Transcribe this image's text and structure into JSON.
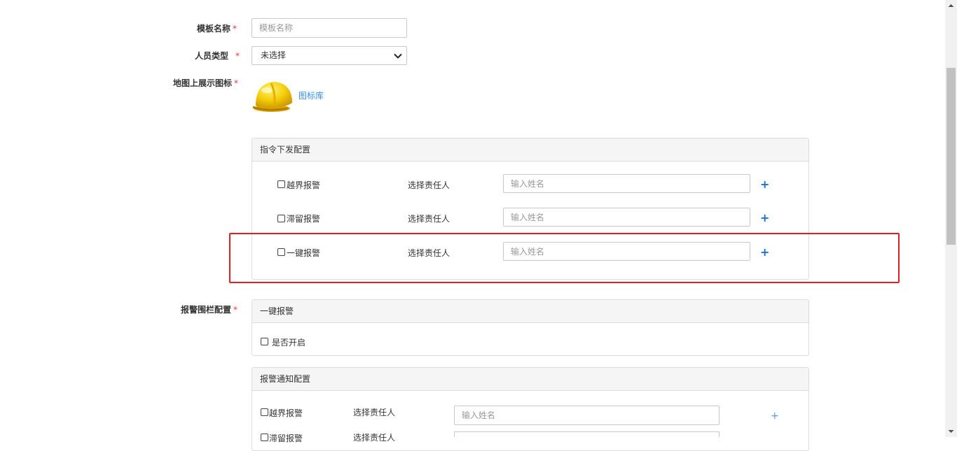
{
  "form": {
    "template_name": {
      "label": "模板名称",
      "required_mark": "*",
      "placeholder": "模板名称",
      "value": ""
    },
    "person_type": {
      "label": "人员类型",
      "required_mark": "*",
      "selected": "未选择"
    },
    "map_icon": {
      "label": "地图上展示图标",
      "required_mark": "*",
      "icon": "yellow-helmet-icon",
      "library_link": "图标库"
    },
    "alarm_fence": {
      "label": "报警围栏配置",
      "required_mark": "*"
    }
  },
  "command_panel": {
    "title": "指令下发配置",
    "rows": [
      {
        "checkbox_label": "越界报警",
        "responsible_label": "选择责任人",
        "placeholder": "输入姓名",
        "add": "+"
      },
      {
        "checkbox_label": "滞留报警",
        "responsible_label": "选择责任人",
        "placeholder": "输入姓名",
        "add": "+"
      },
      {
        "checkbox_label": "一键报警",
        "responsible_label": "选择责任人",
        "placeholder": "输入姓名",
        "add": "+"
      }
    ]
  },
  "oneclick_panel": {
    "title": "一键报警",
    "enable_label": "是否开启"
  },
  "notify_panel": {
    "title": "报警通知配置",
    "rows": [
      {
        "checkbox_label": "越界报警",
        "responsible_label": "选择责任人",
        "placeholder": "输入姓名",
        "add": "+"
      },
      {
        "checkbox_label": "滞留报警",
        "responsible_label": "选择责任人"
      }
    ]
  },
  "colors": {
    "required": "#e4393c",
    "link": "#3a8ee6",
    "plus": "#1a73c8",
    "highlight": "#e02020",
    "panel_header": "#f5f5f5"
  }
}
